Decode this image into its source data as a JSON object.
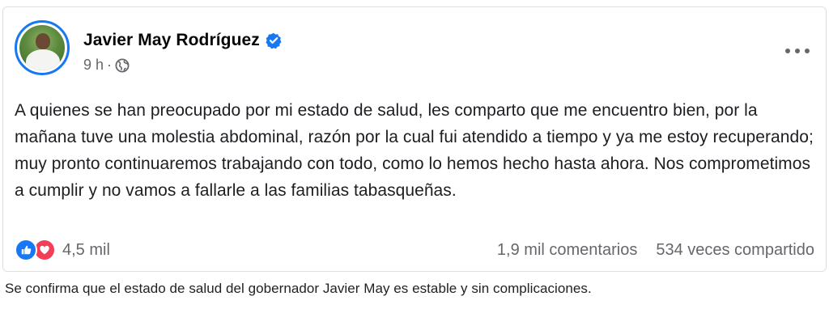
{
  "post": {
    "author": "Javier May Rodríguez",
    "time": "9 h",
    "separator": "·",
    "text": "A quienes se han preocupado por mi estado de salud, les comparto que me encuentro bien, por la mañana tuve una molestia abdominal, razón por la cual fui atendido a tiempo y ya me estoy recuperando; muy pronto continuaremos trabajando con todo, como lo hemos hecho hasta ahora. Nos comprometimos a cumplir y no vamos a fallarle a las familias tabasqueñas.",
    "reactions": {
      "icons": [
        "like-icon",
        "love-icon"
      ],
      "count": "4,5 mil"
    },
    "comments": "1,9 mil comentarios",
    "shares": "534 veces compartido"
  },
  "caption": "Se confirma que el estado de salud del gobernador Javier May es estable y sin complicaciones.",
  "colors": {
    "accent": "#1877f2",
    "love": "#f33e58",
    "secondary_text": "#65676b"
  }
}
